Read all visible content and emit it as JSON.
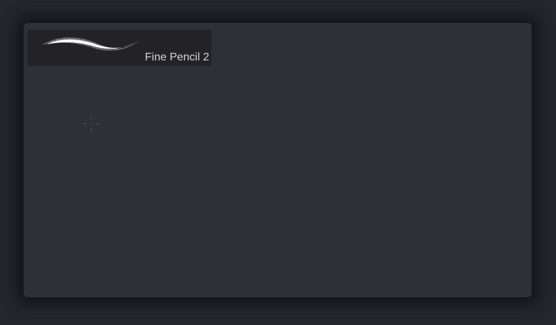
{
  "brush_library": {
    "selected_brush": {
      "name": "Fine Pencil 2",
      "preview_icon": "brush-stroke-preview"
    }
  },
  "canvas": {
    "cursor_icon": "crosshair-cursor"
  },
  "colors": {
    "background": "#25252d",
    "panel": "#2f2f37",
    "brush_item_bg": "#232227",
    "label_text": "#d6d6da"
  }
}
